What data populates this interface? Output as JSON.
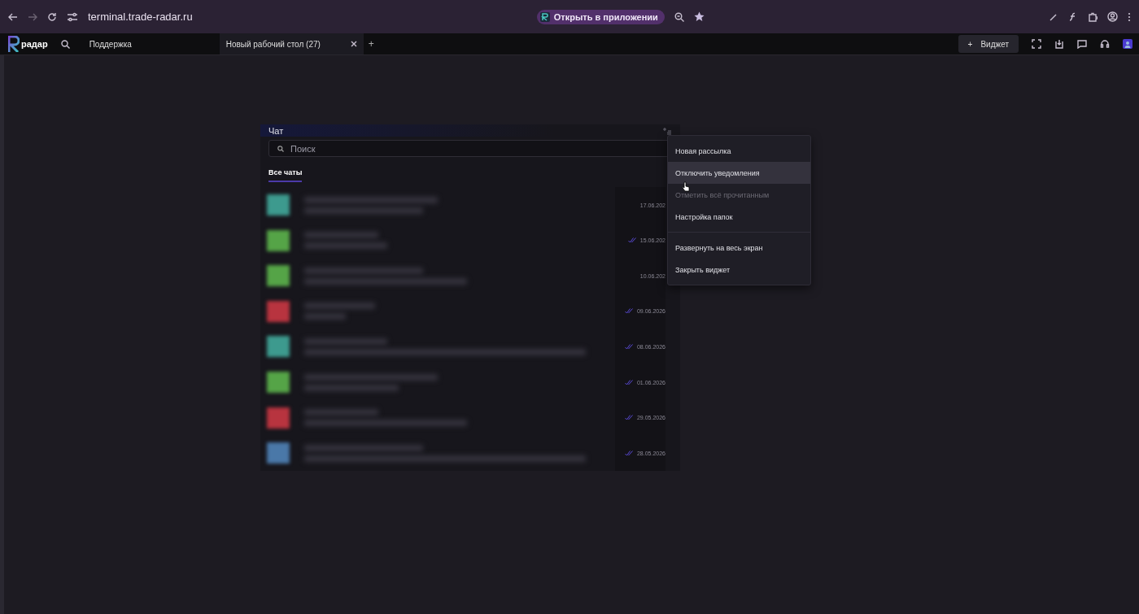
{
  "browser": {
    "url": "terminal.trade-radar.ru",
    "open_in_app": "Открыть в приложении"
  },
  "app_bar": {
    "logo": "радар",
    "tabs": [
      {
        "label": "Поддержка",
        "selected": false
      },
      {
        "label": "Новый рабочий стол (27)",
        "selected": true
      }
    ],
    "add_tab": "+",
    "widget_button": {
      "icon": "+",
      "label": "Виджет"
    }
  },
  "chat": {
    "title": "Чат",
    "search": {
      "placeholder": "Поиск"
    },
    "folders": [
      {
        "label": "Все чаты",
        "selected": true
      }
    ],
    "rows": [
      {
        "color": "#3d9a8e",
        "date": "17.06.202",
        "read": false
      },
      {
        "color": "#55a447",
        "date": "15.06.202",
        "read": true
      },
      {
        "color": "#55a447",
        "date": "10.06.202",
        "read": false
      },
      {
        "color": "#b8343f",
        "date": "09.06.2026",
        "read": true
      },
      {
        "color": "#3d9a8e",
        "date": "08.06.2026",
        "read": true
      },
      {
        "color": "#55a447",
        "date": "01.06.2026",
        "read": true
      },
      {
        "color": "#b8343f",
        "date": "29.05.2026",
        "read": true
      },
      {
        "color": "#4a78a8",
        "date": "28.05.2026",
        "read": true
      }
    ]
  },
  "menu": {
    "items": [
      {
        "kind": "item",
        "label": "Новая рассылка",
        "selected": false,
        "disabled": false
      },
      {
        "kind": "item",
        "label": "Отключить уведомления",
        "selected": true,
        "disabled": false
      },
      {
        "kind": "item",
        "label": "Отметить всё прочитанным",
        "selected": false,
        "disabled": true
      },
      {
        "kind": "item",
        "label": "Настройка папок",
        "selected": false,
        "disabled": false
      },
      {
        "kind": "separator"
      },
      {
        "kind": "item",
        "label": "Развернуть на весь экран",
        "selected": false,
        "disabled": false
      },
      {
        "kind": "item",
        "label": "Закрыть виджет",
        "selected": false,
        "disabled": false
      }
    ]
  }
}
